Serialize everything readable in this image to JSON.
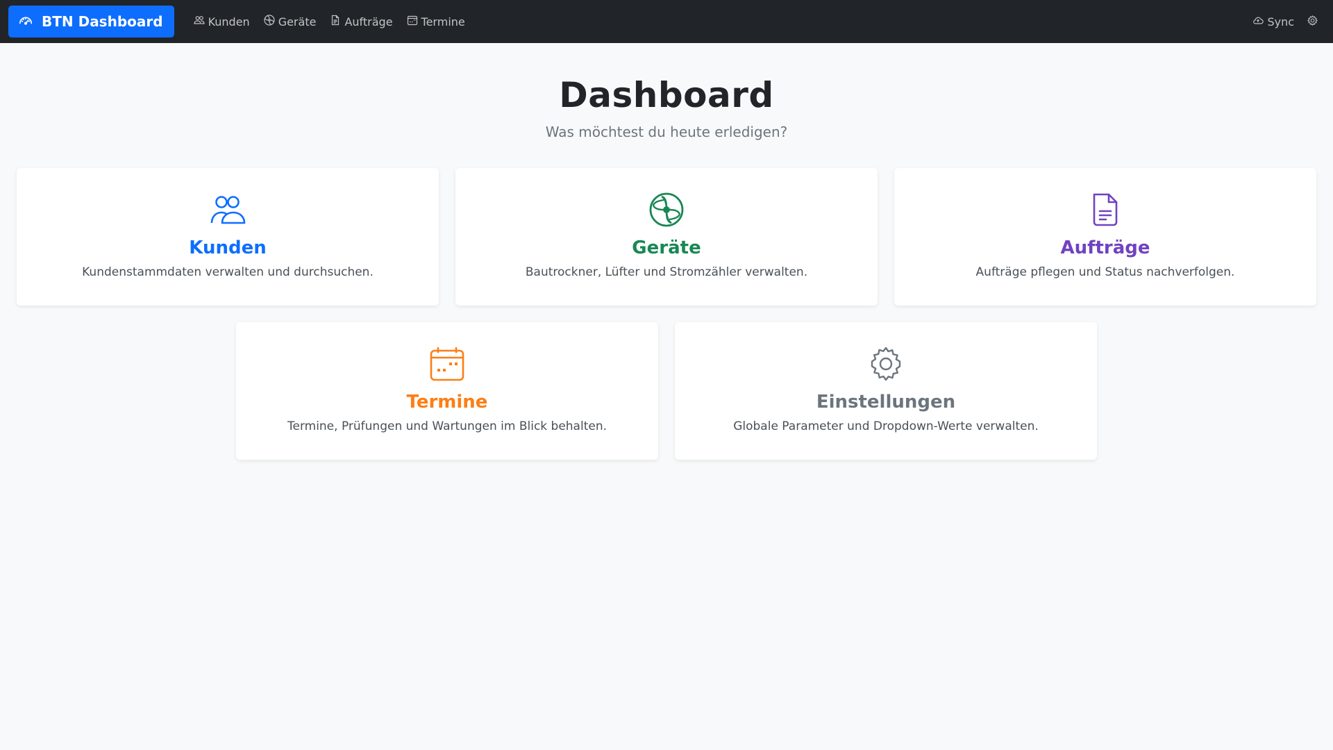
{
  "navbar": {
    "brand": "BTN Dashboard",
    "links": [
      {
        "label": "Kunden",
        "icon": "people-icon"
      },
      {
        "label": "Geräte",
        "icon": "fan-icon"
      },
      {
        "label": "Aufträge",
        "icon": "document-icon"
      },
      {
        "label": "Termine",
        "icon": "calendar-icon"
      }
    ],
    "sync_label": "Sync"
  },
  "header": {
    "title": "Dashboard",
    "subtitle": "Was möchtest du heute erledigen?"
  },
  "cards": [
    {
      "title": "Kunden",
      "description": "Kundenstammdaten verwalten und durchsuchen.",
      "color": "#0d6efd",
      "icon": "people-icon"
    },
    {
      "title": "Geräte",
      "description": "Bautrockner, Lüfter und Stromzähler verwalten.",
      "color": "#198754",
      "icon": "fan-icon"
    },
    {
      "title": "Aufträge",
      "description": "Aufträge pflegen und Status nachverfolgen.",
      "color": "#6f42c1",
      "icon": "document-icon"
    },
    {
      "title": "Termine",
      "description": "Termine, Prüfungen und Wartungen im Blick behalten.",
      "color": "#fd7e14",
      "icon": "calendar-icon"
    },
    {
      "title": "Einstellungen",
      "description": "Globale Parameter und Dropdown-Werte verwalten.",
      "color": "#6c757d",
      "icon": "gear-icon"
    }
  ],
  "colors": {
    "navbar_bg": "#212529",
    "brand_bg": "#0d6efd",
    "page_bg": "#f8f9fa"
  }
}
